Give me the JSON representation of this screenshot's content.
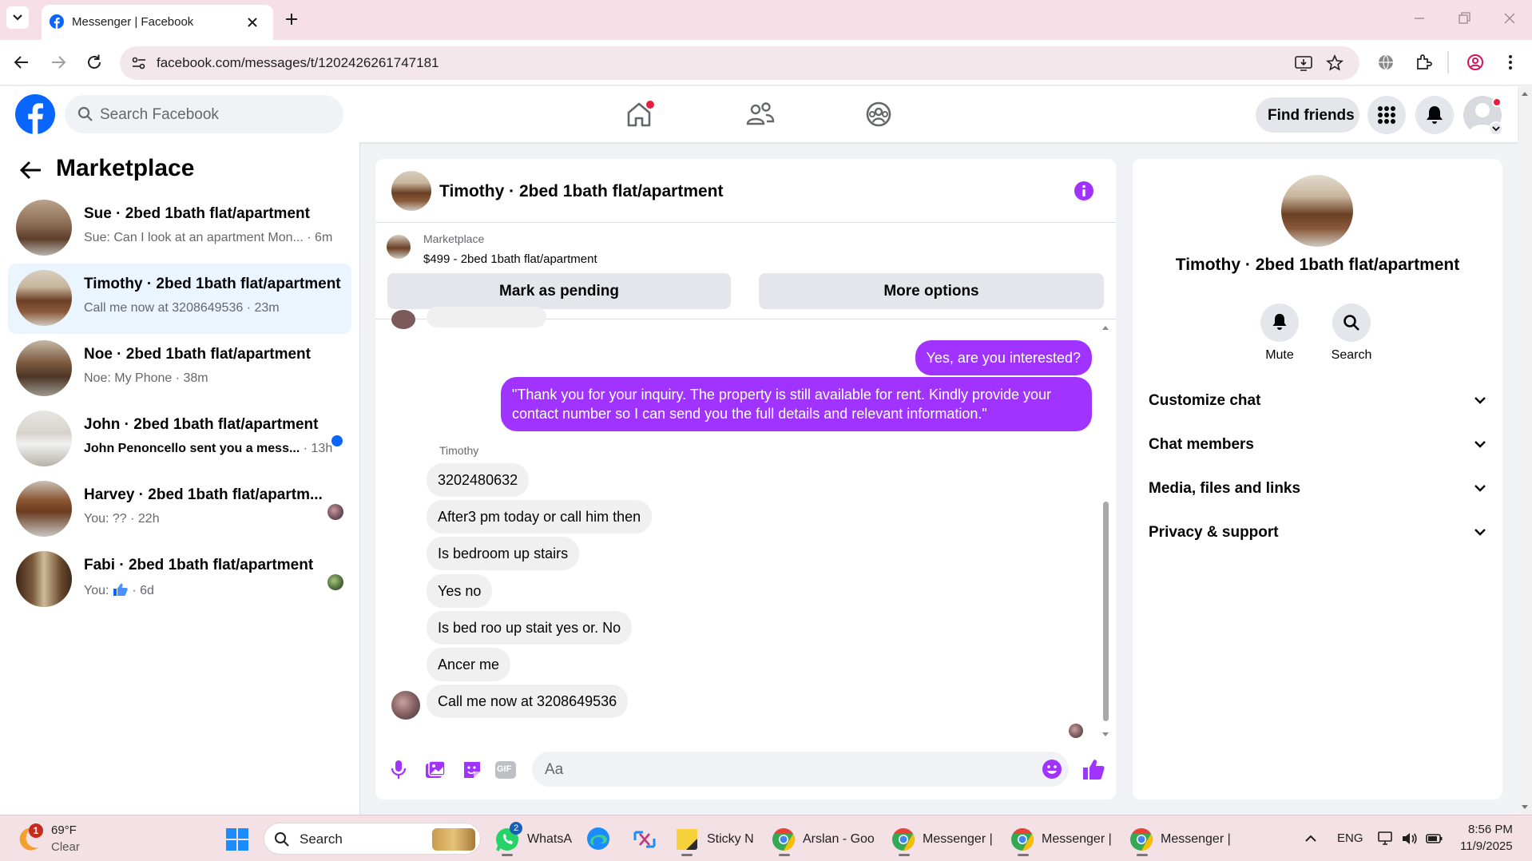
{
  "browser": {
    "tab_title": "Messenger | Facebook",
    "url": "facebook.com/messages/t/1202426261747181"
  },
  "fb_header": {
    "search_placeholder": "Search Facebook",
    "find_friends": "Find friends"
  },
  "left": {
    "heading": "Marketplace",
    "conversations": [
      {
        "name": "Sue · 2bed 1bath flat/apartment",
        "snippet": "Sue: Can I look at an apartment Mon... · 6m",
        "selected": false,
        "unread": false
      },
      {
        "name": "Timothy · 2bed 1bath flat/apartment",
        "snippet": "Call me now at 3208649536 · 23m",
        "selected": true,
        "unread": false
      },
      {
        "name": "Noe · 2bed 1bath flat/apartment",
        "snippet": "Noe: My Phone · 38m",
        "selected": false,
        "unread": false
      },
      {
        "name": "John · 2bed 1bath flat/apartment",
        "snippet": "John Penoncello sent you a mess...",
        "snippet_time": "· 13h",
        "selected": false,
        "unread": true
      },
      {
        "name": "Harvey · 2bed 1bath flat/apartm...",
        "snippet": "You: ?? · 22h",
        "selected": false,
        "unread": false
      },
      {
        "name": "Fabi · 2bed 1bath flat/apartment",
        "snippet_prefix": "You: ",
        "snippet": " · 6d",
        "selected": false,
        "unread": false
      }
    ]
  },
  "chat": {
    "title": "Timothy · 2bed 1bath flat/apartment",
    "marketplace_label": "Marketplace",
    "listing": "$499 - 2bed 1bath flat/apartment",
    "mark_pending": "Mark as pending",
    "more_options": "More options",
    "outgoing": [
      "Yes, are you interested?",
      "\"Thank you for your inquiry. The property is still available for rent. Kindly provide your contact number so I can send you the full details and relevant information.\""
    ],
    "sender_name": "Timothy",
    "incoming": [
      "3202480632",
      "After3 pm today or call him then",
      "Is bedroom up stairs",
      "Yes no",
      "Is bed roo up stait yes or. No",
      "Ancer me",
      "Call me now at 3208649536"
    ],
    "composer_placeholder": "Aa",
    "gif_label": "GIF"
  },
  "right": {
    "title": "Timothy · 2bed 1bath flat/apartment",
    "mute": "Mute",
    "search": "Search",
    "sections": [
      "Customize chat",
      "Chat members",
      "Media, files and links",
      "Privacy & support"
    ]
  },
  "taskbar": {
    "weather_temp": "69°F",
    "weather_cond": "Clear",
    "weather_badge": "1",
    "search": "Search",
    "apps": [
      "WhatsA",
      "Sticky N",
      "Arslan - Goo",
      "Messenger |",
      "Messenger |",
      "Messenger |"
    ],
    "whatsapp_badge": "2",
    "lang": "ENG",
    "time": "8:56 PM",
    "date": "11/9/2025"
  },
  "colors": {
    "fb_blue": "#0866ff",
    "messenger_purple": "#a033ff",
    "selected_row": "#ebf5ff",
    "notification_red": "#e41e3f"
  }
}
